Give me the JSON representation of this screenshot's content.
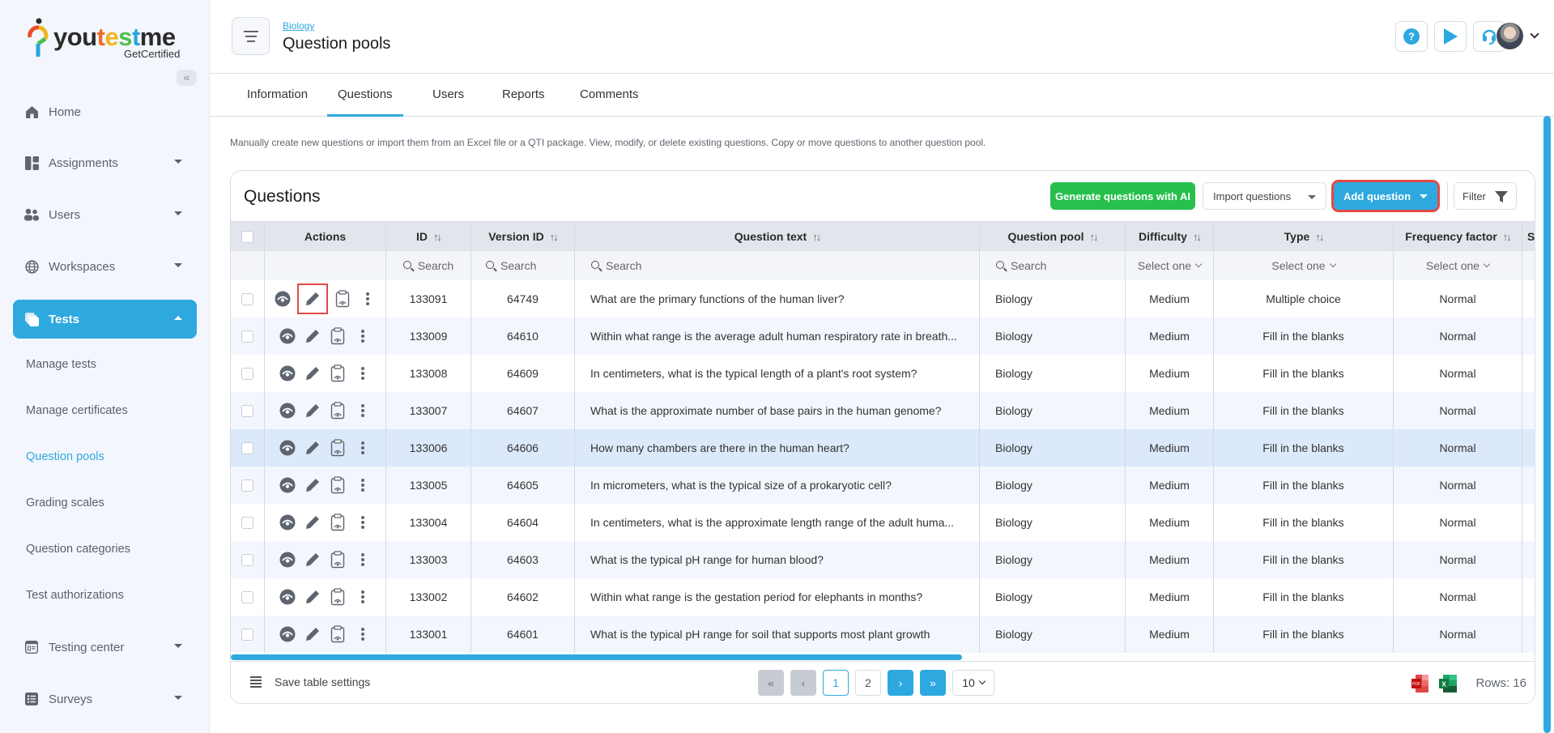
{
  "brand": {
    "name_parts": [
      "you",
      "t",
      "e",
      "s",
      "t",
      "me"
    ],
    "tagline": "GetCertified",
    "collapse_label": "«"
  },
  "sidebar": {
    "items": [
      {
        "label": "Home",
        "icon": "home-icon"
      },
      {
        "label": "Assignments",
        "icon": "assignments-icon"
      },
      {
        "label": "Users",
        "icon": "users-icon"
      },
      {
        "label": "Workspaces",
        "icon": "globe-icon"
      },
      {
        "label": "Tests",
        "icon": "tests-icon"
      },
      {
        "label": "Testing center",
        "icon": "testing-center-icon"
      },
      {
        "label": "Surveys",
        "icon": "surveys-icon"
      }
    ],
    "sub_items": [
      "Manage tests",
      "Manage certificates",
      "Question pools",
      "Grading scales",
      "Question categories",
      "Test authorizations"
    ],
    "active_sub": "Question pools"
  },
  "header": {
    "breadcrumb": "Biology",
    "title": "Question pools"
  },
  "tabs": [
    "Information",
    "Questions",
    "Users",
    "Reports",
    "Comments"
  ],
  "active_tab": "Questions",
  "description": "Manually create new questions or import them from an Excel file or a QTI package. View, modify, or delete existing questions. Copy or move questions to another question pool.",
  "card": {
    "title": "Questions",
    "generate_ai": "Generate questions with AI",
    "import": "Import questions",
    "add": "Add question",
    "filter": "Filter"
  },
  "table": {
    "columns": [
      "Actions",
      "ID",
      "Version ID",
      "Question text",
      "Question pool",
      "Difficulty",
      "Type",
      "Frequency factor",
      "S"
    ],
    "search_placeholder": "Search",
    "select_placeholder": "Select one",
    "rows": [
      {
        "id": "133091",
        "version": "64749",
        "text": "What are the primary functions of the human liver?",
        "pool": "Biology",
        "difficulty": "Medium",
        "type": "Multiple choice",
        "frequency": "Normal"
      },
      {
        "id": "133009",
        "version": "64610",
        "text": "Within what range is the average adult human respiratory rate in breath...",
        "pool": "Biology",
        "difficulty": "Medium",
        "type": "Fill in the blanks",
        "frequency": "Normal"
      },
      {
        "id": "133008",
        "version": "64609",
        "text": "In centimeters, what is the typical length of a plant's root system?",
        "pool": "Biology",
        "difficulty": "Medium",
        "type": "Fill in the blanks",
        "frequency": "Normal"
      },
      {
        "id": "133007",
        "version": "64607",
        "text": "What is the approximate number of base pairs in the human genome?",
        "pool": "Biology",
        "difficulty": "Medium",
        "type": "Fill in the blanks",
        "frequency": "Normal"
      },
      {
        "id": "133006",
        "version": "64606",
        "text": "How many chambers are there in the human heart?",
        "pool": "Biology",
        "difficulty": "Medium",
        "type": "Fill in the blanks",
        "frequency": "Normal"
      },
      {
        "id": "133005",
        "version": "64605",
        "text": "In micrometers, what is the typical size of a prokaryotic cell?",
        "pool": "Biology",
        "difficulty": "Medium",
        "type": "Fill in the blanks",
        "frequency": "Normal"
      },
      {
        "id": "133004",
        "version": "64604",
        "text": "In centimeters, what is the approximate length range of the adult huma...",
        "pool": "Biology",
        "difficulty": "Medium",
        "type": "Fill in the blanks",
        "frequency": "Normal"
      },
      {
        "id": "133003",
        "version": "64603",
        "text": "What is the typical pH range for human blood?",
        "pool": "Biology",
        "difficulty": "Medium",
        "type": "Fill in the blanks",
        "frequency": "Normal"
      },
      {
        "id": "133002",
        "version": "64602",
        "text": "Within what range is the gestation period for elephants in months?",
        "pool": "Biology",
        "difficulty": "Medium",
        "type": "Fill in the blanks",
        "frequency": "Normal"
      },
      {
        "id": "133001",
        "version": "64601",
        "text": "What is the typical pH range for soil that supports most plant growth",
        "pool": "Biology",
        "difficulty": "Medium",
        "type": "Fill in the blanks",
        "frequency": "Normal"
      }
    ],
    "highlighted_row_id": "133006"
  },
  "footer": {
    "save_settings": "Save table settings",
    "pages": [
      "1",
      "2"
    ],
    "current_page": "1",
    "rows_per_page": "10",
    "rows_label": "Rows: 16",
    "export_pdf_label": "PDF",
    "export_excel_label": "X"
  },
  "colors": {
    "accent": "#2ea9df",
    "ai_button": "#27c04c",
    "highlight_outline": "#e24a44",
    "row_highlight": "#dce9fb"
  }
}
